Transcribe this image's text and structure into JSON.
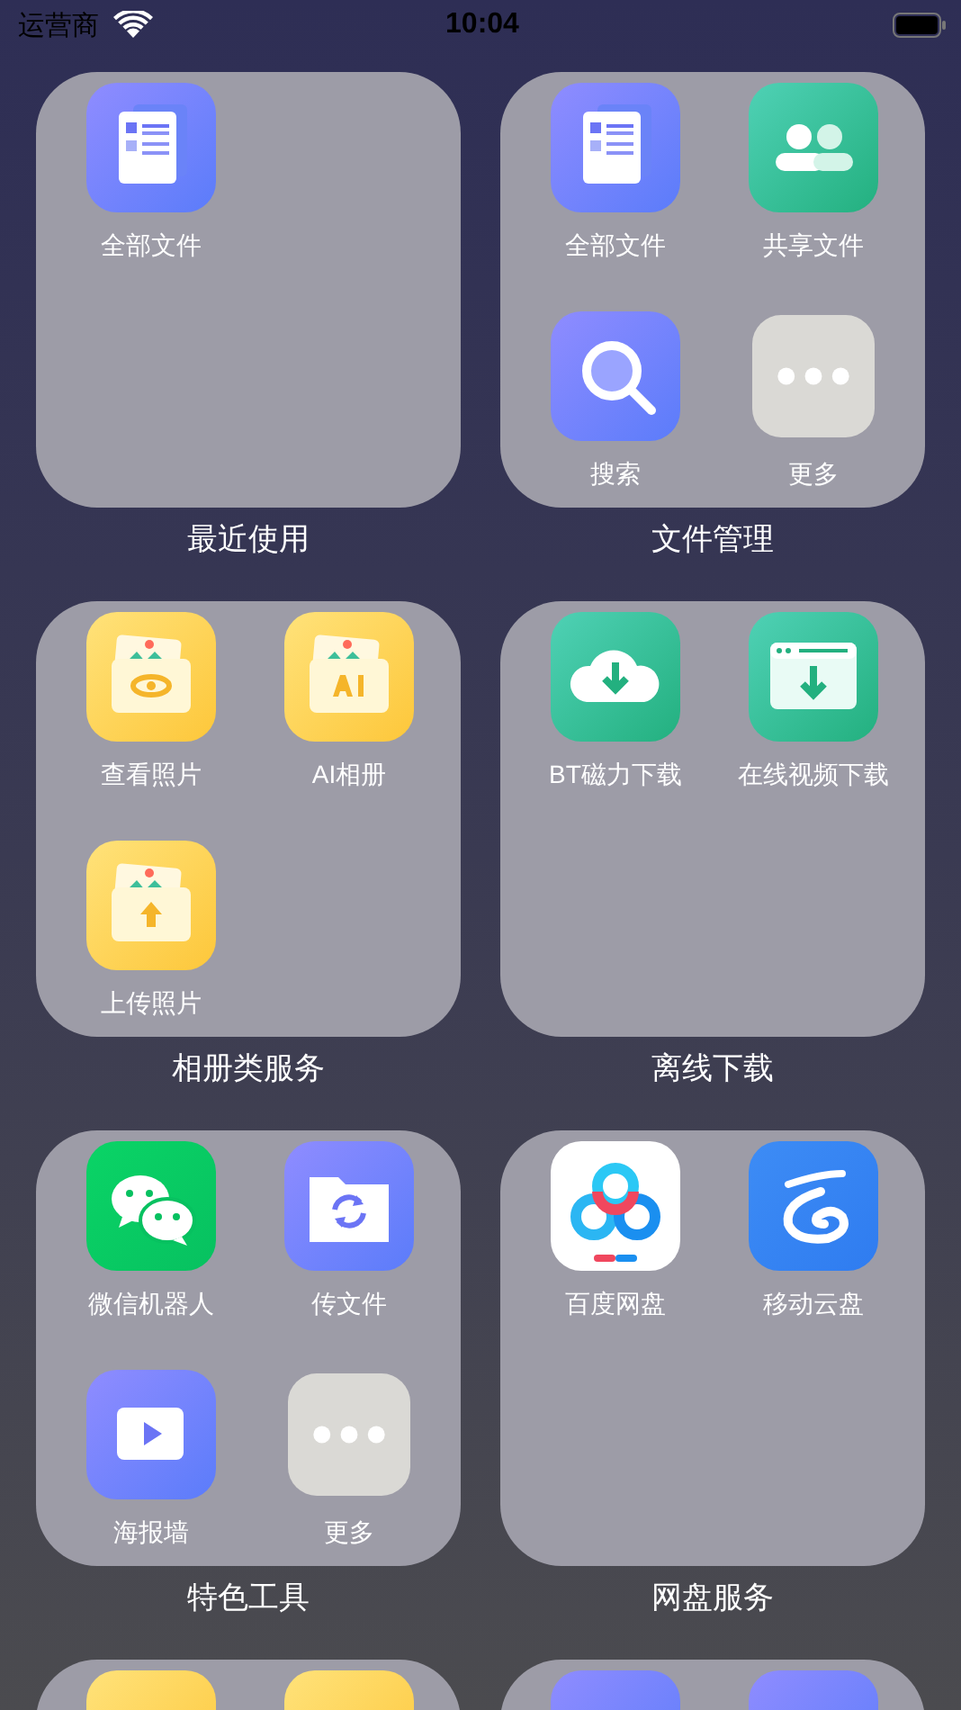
{
  "status_bar": {
    "carrier": "运营商",
    "time": "10:04"
  },
  "folders": [
    {
      "title": "最近使用",
      "apps": [
        {
          "label": "全部文件",
          "kind": "document"
        }
      ]
    },
    {
      "title": "文件管理",
      "apps": [
        {
          "label": "全部文件",
          "kind": "document"
        },
        {
          "label": "共享文件",
          "kind": "people"
        },
        {
          "label": "搜索",
          "kind": "search"
        },
        {
          "label": "更多",
          "kind": "more"
        }
      ]
    },
    {
      "title": "相册类服务",
      "apps": [
        {
          "label": "查看照片",
          "kind": "photo-eye"
        },
        {
          "label": "AI相册",
          "kind": "photo-ai"
        },
        {
          "label": "上传照片",
          "kind": "photo-upload"
        }
      ]
    },
    {
      "title": "离线下载",
      "apps": [
        {
          "label": "BT磁力下载",
          "kind": "cloud-download"
        },
        {
          "label": "在线视频下载",
          "kind": "browser-download"
        }
      ]
    },
    {
      "title": "特色工具",
      "apps": [
        {
          "label": "微信机器人",
          "kind": "chat"
        },
        {
          "label": "传文件",
          "kind": "folder-sync"
        },
        {
          "label": "海报墙",
          "kind": "play"
        },
        {
          "label": "更多",
          "kind": "more"
        }
      ]
    },
    {
      "title": "网盘服务",
      "apps": [
        {
          "label": "百度网盘",
          "kind": "clouds"
        },
        {
          "label": "移动云盘",
          "kind": "swirl"
        }
      ]
    },
    {
      "apps": [
        {
          "kind": "yellow-tile"
        },
        {
          "kind": "yellow-tile"
        }
      ]
    },
    {
      "apps": [
        {
          "kind": "blue-tile"
        },
        {
          "kind": "blue-tile"
        }
      ]
    }
  ]
}
